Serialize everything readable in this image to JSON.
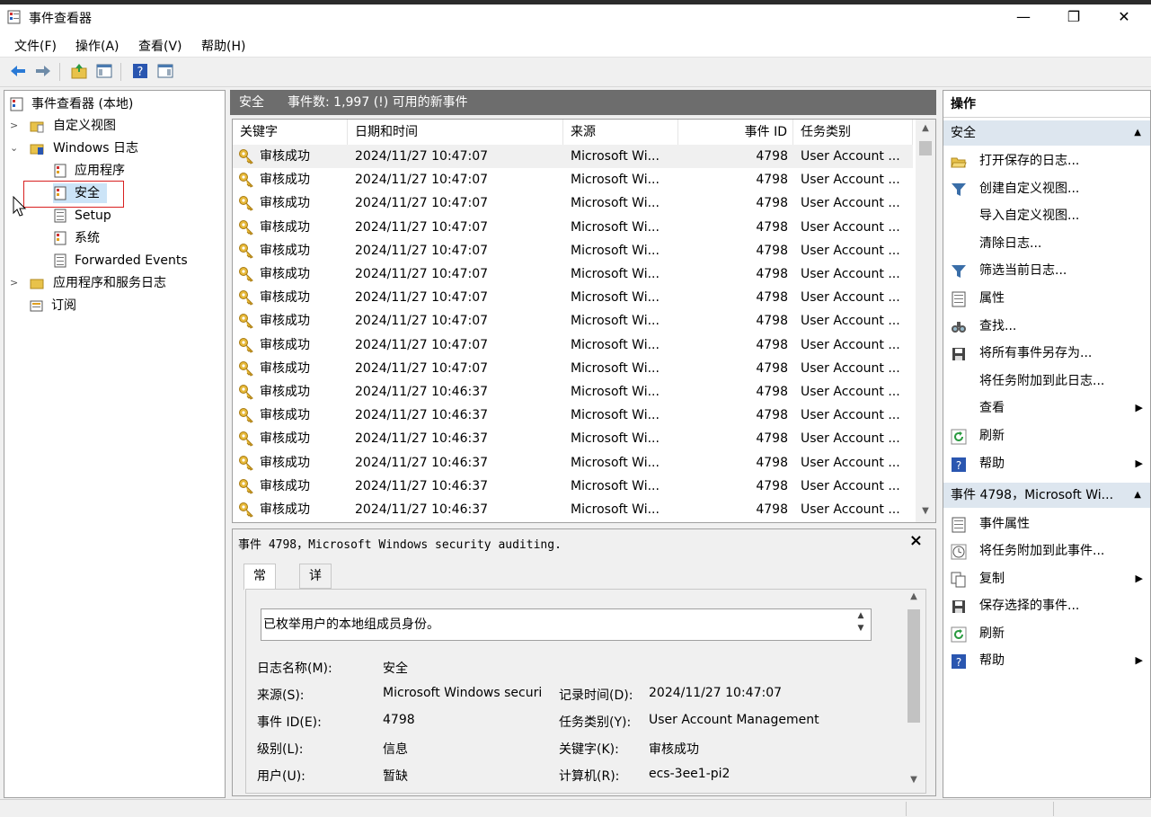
{
  "window": {
    "title": "事件查看器",
    "controls": {
      "minimize": "—",
      "maximize": "❐",
      "close": "✕"
    }
  },
  "menu": [
    "文件(F)",
    "操作(A)",
    "查看(V)",
    "帮助(H)"
  ],
  "tree": {
    "root": "事件查看器 (本地)",
    "custom_views": "自定义视图",
    "windows_logs": "Windows 日志",
    "logs": [
      "应用程序",
      "安全",
      "Setup",
      "系统",
      "Forwarded Events"
    ],
    "app_service_logs": "应用程序和服务日志",
    "subscriptions": "订阅",
    "selected": "安全"
  },
  "list": {
    "header_name": "安全",
    "header_info": "事件数: 1,997 (!) 可用的新事件",
    "columns": [
      "关键字",
      "日期和时间",
      "来源",
      "事件 ID",
      "任务类别"
    ],
    "rows": [
      {
        "keyword": "审核成功",
        "datetime": "2024/11/27 10:47:07",
        "source": "Microsoft Wi...",
        "id": "4798",
        "category": "User Account ..."
      },
      {
        "keyword": "审核成功",
        "datetime": "2024/11/27 10:47:07",
        "source": "Microsoft Wi...",
        "id": "4798",
        "category": "User Account ..."
      },
      {
        "keyword": "审核成功",
        "datetime": "2024/11/27 10:47:07",
        "source": "Microsoft Wi...",
        "id": "4798",
        "category": "User Account ..."
      },
      {
        "keyword": "审核成功",
        "datetime": "2024/11/27 10:47:07",
        "source": "Microsoft Wi...",
        "id": "4798",
        "category": "User Account ..."
      },
      {
        "keyword": "审核成功",
        "datetime": "2024/11/27 10:47:07",
        "source": "Microsoft Wi...",
        "id": "4798",
        "category": "User Account ..."
      },
      {
        "keyword": "审核成功",
        "datetime": "2024/11/27 10:47:07",
        "source": "Microsoft Wi...",
        "id": "4798",
        "category": "User Account ..."
      },
      {
        "keyword": "审核成功",
        "datetime": "2024/11/27 10:47:07",
        "source": "Microsoft Wi...",
        "id": "4798",
        "category": "User Account ..."
      },
      {
        "keyword": "审核成功",
        "datetime": "2024/11/27 10:47:07",
        "source": "Microsoft Wi...",
        "id": "4798",
        "category": "User Account ..."
      },
      {
        "keyword": "审核成功",
        "datetime": "2024/11/27 10:47:07",
        "source": "Microsoft Wi...",
        "id": "4798",
        "category": "User Account ..."
      },
      {
        "keyword": "审核成功",
        "datetime": "2024/11/27 10:47:07",
        "source": "Microsoft Wi...",
        "id": "4798",
        "category": "User Account ..."
      },
      {
        "keyword": "审核成功",
        "datetime": "2024/11/27 10:46:37",
        "source": "Microsoft Wi...",
        "id": "4798",
        "category": "User Account ..."
      },
      {
        "keyword": "审核成功",
        "datetime": "2024/11/27 10:46:37",
        "source": "Microsoft Wi...",
        "id": "4798",
        "category": "User Account ..."
      },
      {
        "keyword": "审核成功",
        "datetime": "2024/11/27 10:46:37",
        "source": "Microsoft Wi...",
        "id": "4798",
        "category": "User Account ..."
      },
      {
        "keyword": "审核成功",
        "datetime": "2024/11/27 10:46:37",
        "source": "Microsoft Wi...",
        "id": "4798",
        "category": "User Account ..."
      },
      {
        "keyword": "审核成功",
        "datetime": "2024/11/27 10:46:37",
        "source": "Microsoft Wi...",
        "id": "4798",
        "category": "User Account ..."
      },
      {
        "keyword": "审核成功",
        "datetime": "2024/11/27 10:46:37",
        "source": "Microsoft Wi...",
        "id": "4798",
        "category": "User Account ..."
      }
    ]
  },
  "detail": {
    "title": "事件 4798，Microsoft Windows security auditing.",
    "close": "×",
    "tabs": [
      "常规",
      "详细信息"
    ],
    "description": "已枚举用户的本地组成员身份。",
    "fields": {
      "log_name_label": "日志名称(M):",
      "log_name": "安全",
      "source_label": "来源(S):",
      "source": "Microsoft Windows securi",
      "logged_label": "记录时间(D):",
      "logged": "2024/11/27 10:47:07",
      "event_id_label": "事件 ID(E):",
      "event_id": "4798",
      "task_label": "任务类别(Y):",
      "task": "User Account Management",
      "level_label": "级别(L):",
      "level": "信息",
      "keywords_label": "关键字(K):",
      "keywords": "审核成功",
      "user_label": "用户(U):",
      "user": "暂缺",
      "computer_label": "计算机(R):",
      "computer": "ecs-3ee1-pi2"
    }
  },
  "actions": {
    "header": "操作",
    "section1": "安全",
    "items1": [
      "打开保存的日志...",
      "创建自定义视图...",
      "导入自定义视图...",
      "清除日志...",
      "筛选当前日志...",
      "属性",
      "查找...",
      "将所有事件另存为...",
      "将任务附加到此日志...",
      "查看",
      "刷新",
      "帮助"
    ],
    "section2": "事件 4798，Microsoft Wi...",
    "items2": [
      "事件属性",
      "将任务附加到此事件...",
      "复制",
      "保存选择的事件...",
      "刷新",
      "帮助"
    ]
  }
}
